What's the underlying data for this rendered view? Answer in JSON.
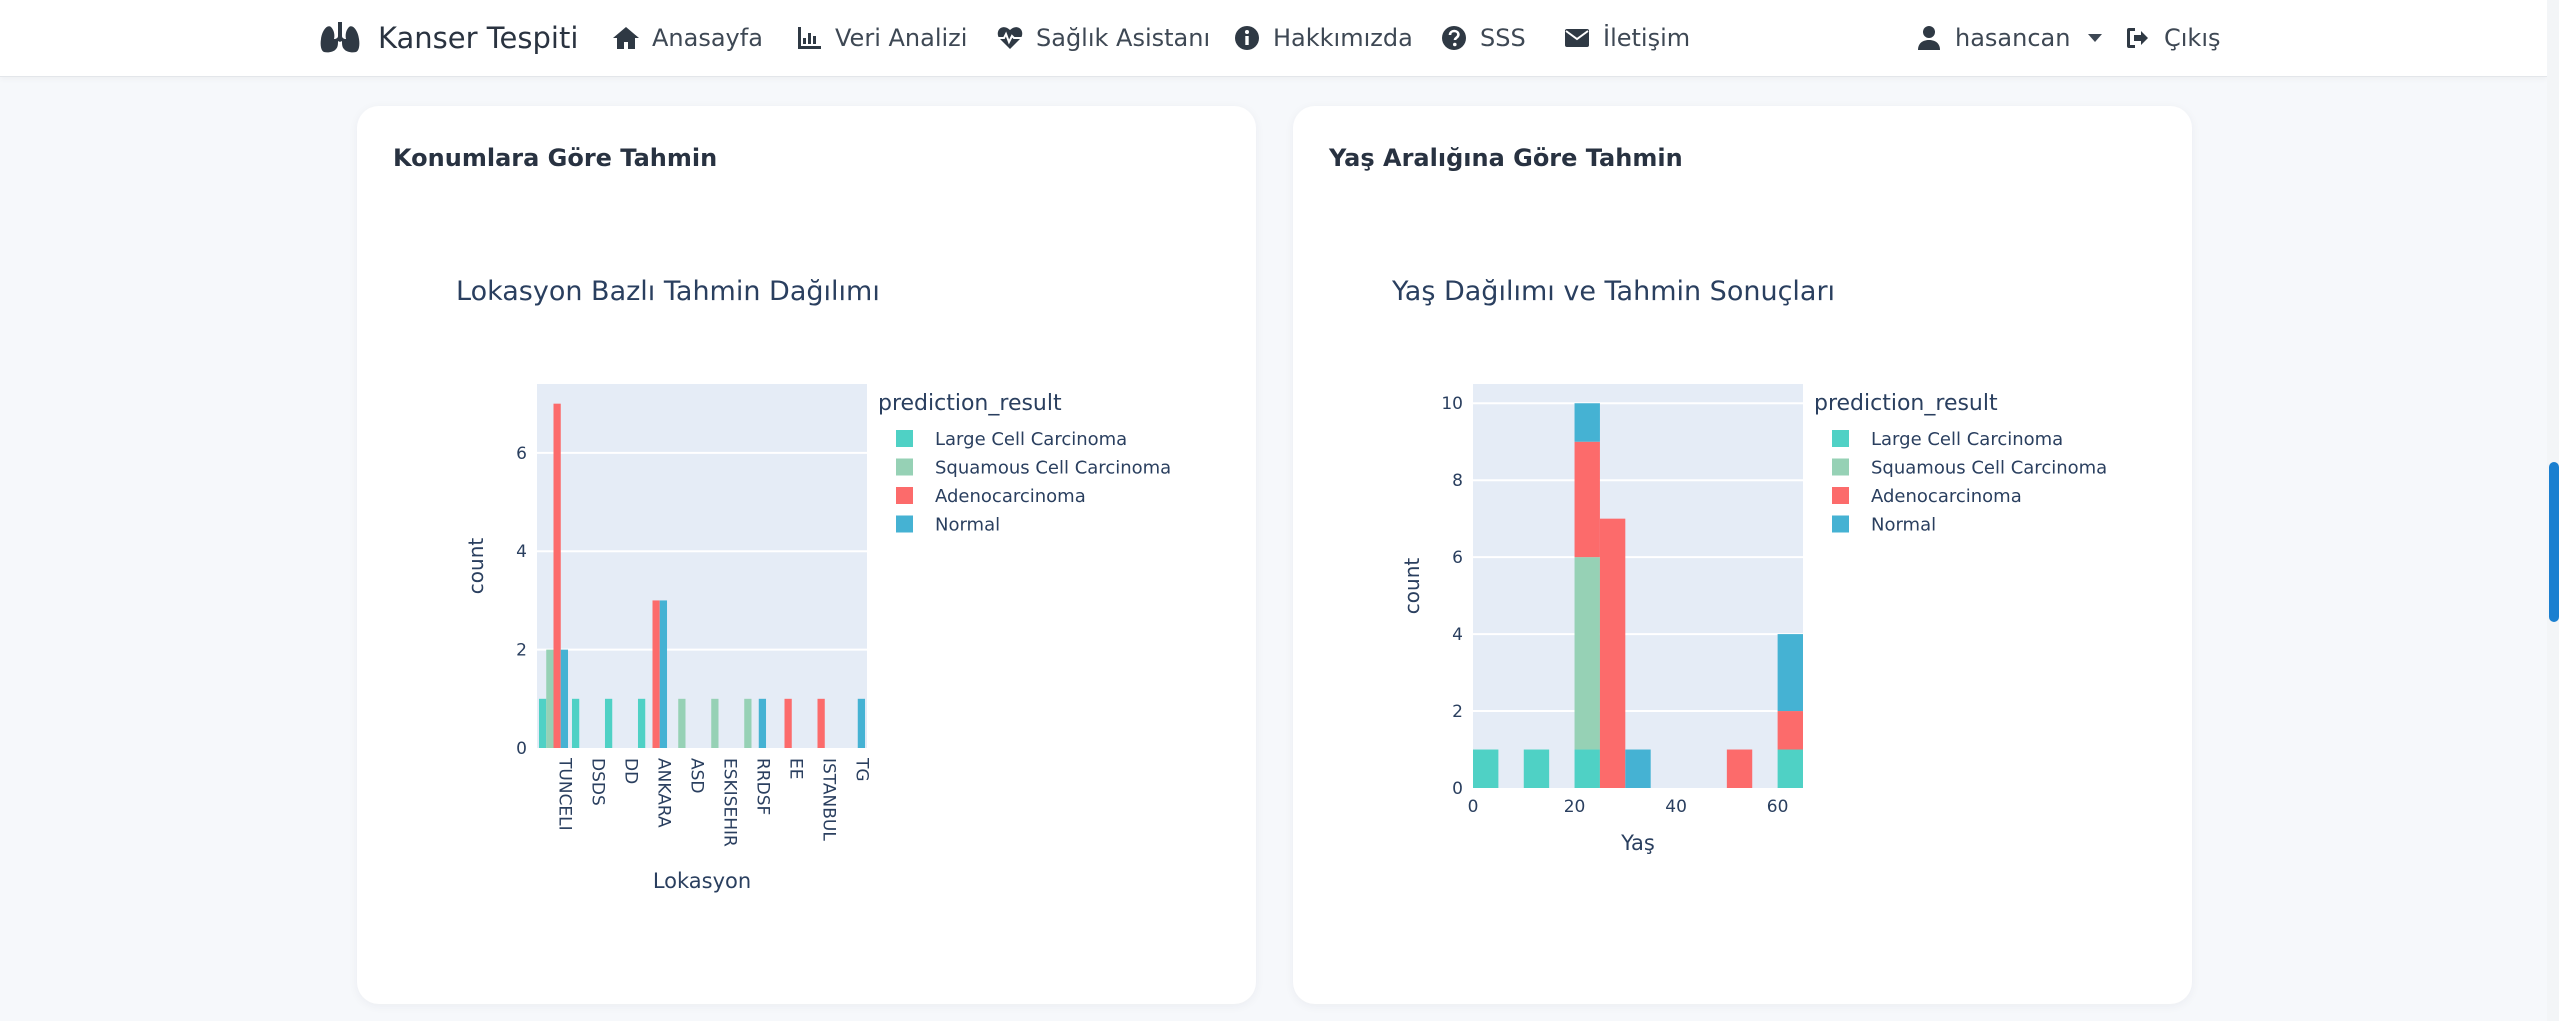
{
  "nav": {
    "brand": "Kanser Tespiti",
    "items": [
      {
        "label": "Anasayfa",
        "icon": "home-icon"
      },
      {
        "label": "Veri Analizi",
        "icon": "chart-line-icon"
      },
      {
        "label": "Sağlık Asistanı",
        "icon": "heartbeat-icon"
      },
      {
        "label": "Hakkımızda",
        "icon": "info-circle-icon"
      },
      {
        "label": "SSS",
        "icon": "question-circle-icon"
      },
      {
        "label": "İletişim",
        "icon": "envelope-icon"
      }
    ],
    "user": "hasancan",
    "logout": "Çıkış"
  },
  "cards": {
    "location": {
      "title": "Konumlara Göre Tahmin"
    },
    "age": {
      "title": "Yaş Aralığına Göre Tahmin"
    }
  },
  "colors": {
    "Large Cell Carcinoma": "#4fd1c5",
    "Squamous Cell Carcinoma": "#96d1b5",
    "Adenocarcinoma": "#fc6b6b",
    "Normal": "#45b2d3",
    "plot_bg": "#e5ecf6"
  },
  "chart_data": [
    {
      "type": "bar",
      "barmode": "group",
      "title": "Lokasyon Bazlı Tahmin Dağılımı",
      "xlabel": "Lokasyon",
      "ylabel": "count",
      "legend_title": "prediction_result",
      "legend_position": "right",
      "ylim": [
        0,
        7.4
      ],
      "yticks": [
        0,
        2,
        4,
        6
      ],
      "categories": [
        "TUNCELI",
        "DSDS",
        "DD",
        "ANKARA",
        "ASD",
        "ESKISEHIR",
        "RRDSF",
        "EE",
        "ISTANBUL",
        "TG"
      ],
      "series": [
        {
          "name": "Large Cell Carcinoma",
          "values": [
            1,
            1,
            1,
            1,
            0,
            0,
            0,
            0,
            0,
            0
          ]
        },
        {
          "name": "Squamous Cell Carcinoma",
          "values": [
            2,
            0,
            0,
            0,
            1,
            1,
            1,
            0,
            0,
            0
          ]
        },
        {
          "name": "Adenocarcinoma",
          "values": [
            7,
            0,
            0,
            3,
            0,
            0,
            0,
            1,
            1,
            0
          ]
        },
        {
          "name": "Normal",
          "values": [
            2,
            0,
            0,
            3,
            0,
            0,
            1,
            0,
            0,
            1
          ]
        }
      ]
    },
    {
      "type": "bar",
      "barmode": "stack",
      "title": "Yaş Dağılımı ve Tahmin Sonuçları",
      "xlabel": "Yaş",
      "ylabel": "count",
      "legend_title": "prediction_result",
      "legend_position": "right",
      "xlim": [
        0,
        65
      ],
      "xticks": [
        0,
        20,
        40,
        60
      ],
      "ylim": [
        0,
        10.5
      ],
      "yticks": [
        0,
        2,
        4,
        6,
        8,
        10
      ],
      "bins": [
        0,
        5,
        10,
        15,
        20,
        25,
        30,
        35,
        40,
        45,
        50,
        55,
        60,
        65
      ],
      "series": [
        {
          "name": "Large Cell Carcinoma",
          "values": [
            1,
            0,
            1,
            0,
            1,
            0,
            0,
            0,
            0,
            0,
            0,
            0,
            1
          ]
        },
        {
          "name": "Squamous Cell Carcinoma",
          "values": [
            0,
            0,
            0,
            0,
            5,
            0,
            0,
            0,
            0,
            0,
            0,
            0,
            0
          ]
        },
        {
          "name": "Adenocarcinoma",
          "values": [
            0,
            0,
            0,
            0,
            3,
            7,
            0,
            0,
            0,
            0,
            1,
            0,
            1
          ]
        },
        {
          "name": "Normal",
          "values": [
            0,
            0,
            0,
            0,
            1,
            0,
            1,
            0,
            0,
            0,
            0,
            0,
            2
          ]
        }
      ]
    }
  ]
}
